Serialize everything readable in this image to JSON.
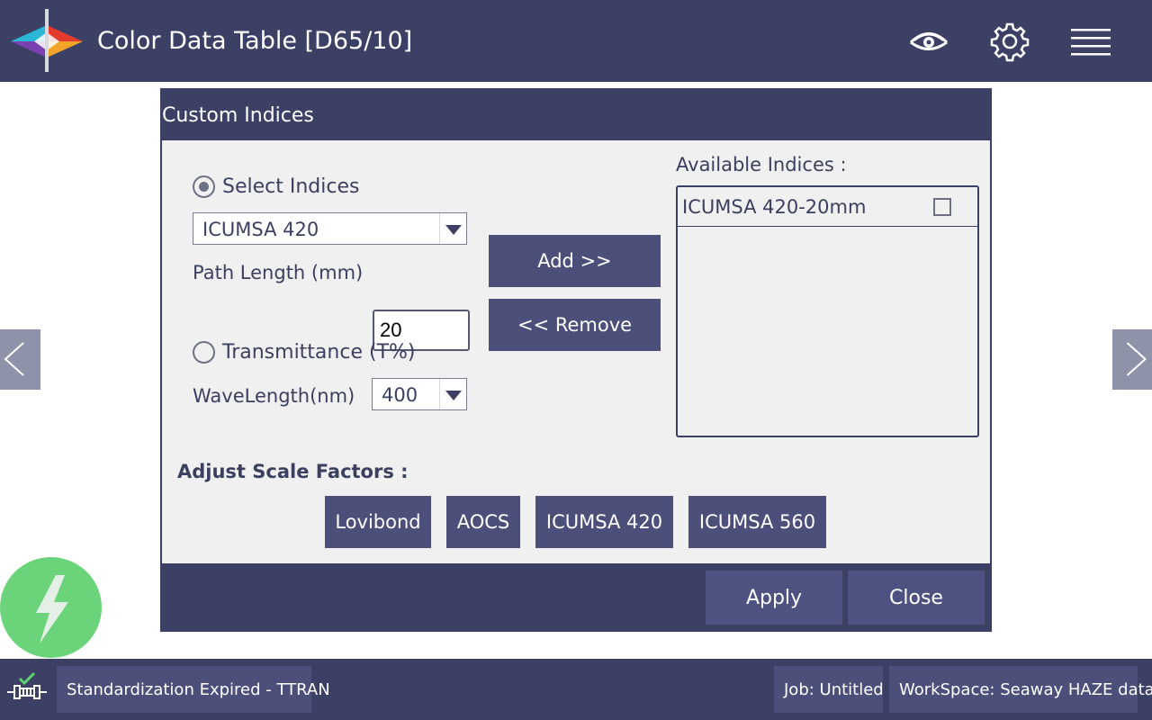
{
  "header": {
    "title": "Color Data Table [D65/10]",
    "icons": [
      "app-logo-icon",
      "eye-icon",
      "gear-icon",
      "hamburger-menu-icon"
    ]
  },
  "dialog": {
    "title": "Custom Indices",
    "select_indices": {
      "label": "Select Indices",
      "checked": true,
      "value": "ICUMSA 420"
    },
    "path_length": {
      "label": "Path Length (mm)",
      "value": "20"
    },
    "transmittance": {
      "label": "Transmittance (T%)",
      "checked": false
    },
    "wavelength": {
      "label": "WaveLength(nm)",
      "value": "400"
    },
    "add_label": "Add >>",
    "remove_label": "<< Remove",
    "available": {
      "label": "Available Indices :",
      "items": [
        {
          "label": "ICUMSA 420-20mm",
          "checked": false
        }
      ]
    },
    "scale_factors": {
      "label": "Adjust Scale Factors :",
      "buttons": [
        "Lovibond",
        "AOCS",
        "ICUMSA 420",
        "ICUMSA 560"
      ]
    },
    "apply_label": "Apply",
    "close_label": "Close"
  },
  "status": {
    "standardization": "Standardization Expired - TTRAN",
    "job": "Job: Untitled",
    "workspace": "WorkSpace: Seaway HAZE data"
  },
  "colors": {
    "primary": "#3b4064",
    "button": "#4b4f7a",
    "panel": "#f0f0f0",
    "fab": "#6bd47a"
  }
}
